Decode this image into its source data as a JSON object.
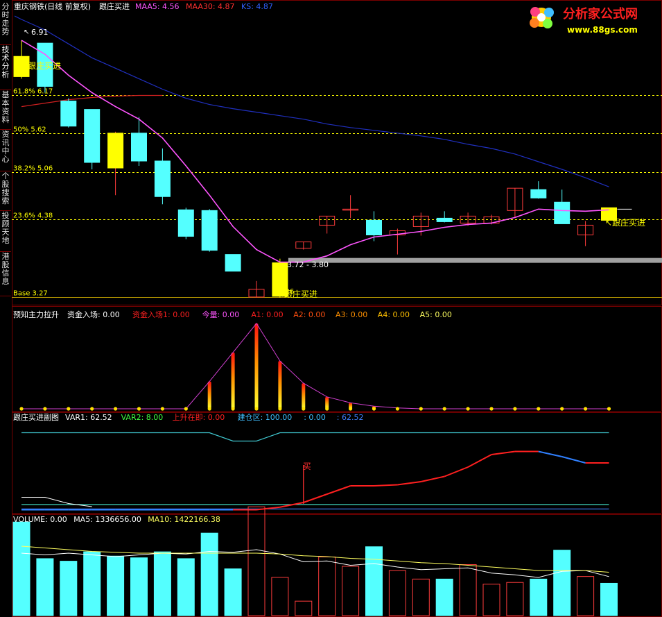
{
  "sidebar": {
    "tabs": [
      "分时走势",
      "技术分析",
      "基本资料",
      "资讯中心",
      "个股搜索",
      "投顾天地",
      "港股信息"
    ],
    "active": 1
  },
  "main": {
    "title": "重庆钢铁(日线 前复权)",
    "indicator_name": "跟庄买进",
    "items": [
      {
        "label": "MAA5:",
        "value": "4.56",
        "color": "#ff55ff"
      },
      {
        "label": "MAA30:",
        "value": "4.87",
        "color": "#ff3030"
      },
      {
        "label": "KS:",
        "value": "4.87",
        "color": "#3060ff"
      }
    ],
    "fib_levels": [
      {
        "label": "61.8% 6.17",
        "price": 6.17
      },
      {
        "label": "50% 5.62",
        "price": 5.62
      },
      {
        "label": "38.2% 5.06",
        "price": 5.06
      },
      {
        "label": "23.6% 4.38",
        "price": 4.38
      },
      {
        "label": "Base 3.27",
        "price": 3.27
      }
    ],
    "high_mark": "6.91",
    "low_mark": "3.26",
    "range_label": "3.72 - 3.80",
    "signal_label": "跟庄买进"
  },
  "panel1": {
    "title": "预知主力拉升",
    "items": [
      {
        "label": "资金入场:",
        "value": "0.00",
        "color": "#ffffff"
      },
      {
        "label": "资金入场1:",
        "value": "0.00",
        "color": "#ff2020"
      },
      {
        "label": "今量:",
        "value": "0.00",
        "color": "#ff55ff"
      },
      {
        "label": "A1:",
        "value": "0.00",
        "color": "#ff2020"
      },
      {
        "label": "A2:",
        "value": "0.00",
        "color": "#ff5010"
      },
      {
        "label": "A3:",
        "value": "0.00",
        "color": "#ff9000"
      },
      {
        "label": "A4:",
        "value": "0.00",
        "color": "#ffc000"
      },
      {
        "label": "A5:",
        "value": "0.00",
        "color": "#ffff60"
      }
    ]
  },
  "panel2": {
    "title": "跟庄买进副图",
    "items": [
      {
        "label": "VAR1:",
        "value": "62.52",
        "color": "#ffffff"
      },
      {
        "label": "VAR2:",
        "value": "8.00",
        "color": "#40ff40"
      },
      {
        "label": "上升在即:",
        "value": "0.00",
        "color": "#ff2020"
      },
      {
        "label": "建仓区:",
        "value": "100.00",
        "color": "#40c0ff"
      },
      {
        "label": ":",
        "value": "0.00",
        "color": "#40c0ff"
      },
      {
        "label": ":",
        "value": "62.52",
        "color": "#4080ff"
      }
    ],
    "buy_label": "买"
  },
  "panel3": {
    "title": "VOLUME:",
    "items": [
      {
        "label": "VOLUME:",
        "value": "0.00",
        "color": "#ffffff"
      },
      {
        "label": "MA5:",
        "value": "1336656.00",
        "color": "#ffffff"
      },
      {
        "label": "MA10:",
        "value": "1422166.38",
        "color": "#ffff60"
      }
    ]
  },
  "logo": {
    "text": "分析家公式网",
    "url": "www.88gs.com"
  },
  "colors": {
    "up": "#ff3c3c",
    "down": "#54ffff",
    "signal": "#ffff00",
    "ma5": "#ff55ff",
    "ma30": "#d02020",
    "ks": "#2030c0",
    "grid": "#7a0000"
  },
  "candles": [
    {
      "o": 6.72,
      "h": 6.95,
      "l": 6.4,
      "c": 6.43,
      "sig": true
    },
    {
      "o": 6.91,
      "h": 6.91,
      "l": 6.2,
      "c": 6.29
    },
    {
      "o": 6.08,
      "h": 6.12,
      "l": 5.7,
      "c": 5.72
    },
    {
      "o": 5.96,
      "h": 5.96,
      "l": 5.1,
      "c": 5.2
    },
    {
      "o": 5.62,
      "h": 5.64,
      "l": 4.73,
      "c": 5.12,
      "sig": true
    },
    {
      "o": 5.62,
      "h": 5.85,
      "l": 5.15,
      "c": 5.22
    },
    {
      "o": 5.22,
      "h": 5.4,
      "l": 4.6,
      "c": 4.71
    },
    {
      "o": 4.52,
      "h": 4.55,
      "l": 4.1,
      "c": 4.14
    },
    {
      "o": 4.51,
      "h": 4.53,
      "l": 3.92,
      "c": 3.94
    },
    {
      "o": 3.88,
      "h": 3.88,
      "l": 3.64,
      "c": 3.64
    },
    {
      "o": 3.27,
      "h": 3.5,
      "l": 3.26,
      "c": 3.38
    },
    {
      "o": 3.28,
      "h": 3.82,
      "l": 3.26,
      "c": 3.76,
      "sig": true
    },
    {
      "o": 3.97,
      "h": 4.06,
      "l": 3.95,
      "c": 4.06
    },
    {
      "o": 4.3,
      "h": 4.43,
      "l": 4.18,
      "c": 4.43
    },
    {
      "o": 4.52,
      "h": 4.73,
      "l": 4.4,
      "c": 4.53
    },
    {
      "o": 4.37,
      "h": 4.5,
      "l": 4.07,
      "c": 4.16
    },
    {
      "o": 4.16,
      "h": 4.25,
      "l": 3.88,
      "c": 4.22
    },
    {
      "o": 4.28,
      "h": 4.48,
      "l": 4.15,
      "c": 4.43
    },
    {
      "o": 4.4,
      "h": 4.5,
      "l": 4.34,
      "c": 4.35
    },
    {
      "o": 4.33,
      "h": 4.48,
      "l": 4.29,
      "c": 4.43
    },
    {
      "o": 4.33,
      "h": 4.45,
      "l": 4.31,
      "c": 4.42
    },
    {
      "o": 4.51,
      "h": 4.83,
      "l": 4.41,
      "c": 4.83
    },
    {
      "o": 4.81,
      "h": 4.93,
      "l": 4.68,
      "c": 4.69
    },
    {
      "o": 4.63,
      "h": 4.81,
      "l": 4.35,
      "c": 4.32
    },
    {
      "o": 4.16,
      "h": 4.36,
      "l": 4.0,
      "c": 4.3
    },
    {
      "o": 4.55,
      "h": 4.55,
      "l": 4.37,
      "c": 4.37,
      "sig": true
    }
  ],
  "maa5": [
    6.95,
    6.75,
    6.45,
    6.2,
    6.0,
    5.82,
    5.55,
    5.15,
    4.73,
    4.28,
    3.95,
    3.77,
    3.77,
    3.86,
    4.02,
    4.13,
    4.17,
    4.21,
    4.27,
    4.31,
    4.33,
    4.41,
    4.53,
    4.51,
    4.5,
    4.52
  ],
  "maa30": [
    6.0,
    6.05,
    6.1,
    6.13,
    6.15,
    6.16,
    6.16
  ],
  "ks": [
    7.25,
    7.1,
    6.9,
    6.7,
    6.55,
    6.4,
    6.25,
    6.12,
    6.03,
    5.97,
    5.92,
    5.87,
    5.82,
    5.75,
    5.7,
    5.66,
    5.62,
    5.58,
    5.53,
    5.46,
    5.4,
    5.32,
    5.21,
    5.1,
    4.98,
    4.85
  ],
  "fund_bars": [
    0,
    0,
    0,
    0,
    0,
    0,
    0,
    0,
    0.32,
    0.66,
    1.0,
    0.56,
    0.3,
    0.14,
    0.07,
    0.03,
    0.01,
    0,
    0,
    0,
    0,
    0,
    0,
    0,
    0,
    0
  ],
  "panel2_series": {
    "var1": [
      75,
      75,
      75,
      75,
      75,
      75,
      75,
      75,
      75,
      67,
      67,
      75,
      75,
      75,
      75,
      75,
      75,
      75,
      75,
      75,
      75,
      75,
      75,
      75,
      75,
      75
    ],
    "red": [
      1.0,
      1.0,
      1.0,
      1.0,
      1.0,
      1.0,
      1.0,
      1.0,
      1.0,
      1.0,
      1.0,
      3.5,
      8,
      16,
      24,
      24,
      25,
      28,
      33,
      42,
      54,
      57,
      57,
      52,
      46,
      46
    ],
    "low_line": [
      6,
      6,
      6,
      6,
      6,
      6,
      6,
      6,
      6,
      6,
      6,
      6,
      6,
      6,
      6,
      6,
      6,
      6,
      6,
      6,
      6,
      6,
      6,
      6,
      6,
      6
    ],
    "low_line2": [
      1.5,
      1.5,
      1.5,
      1.5,
      1.5,
      1.5,
      1.5,
      1.5,
      1.5,
      1.5,
      1.5,
      1.5,
      1.5,
      1.5,
      1.5,
      1.5,
      1.5,
      1.5,
      1.5,
      1.5,
      1.5,
      1.5,
      1.5,
      1.5,
      1.5,
      1.5
    ],
    "white": [
      13,
      13,
      7,
      4,
      4,
      4,
      4,
      4,
      4,
      4,
      4,
      4,
      4,
      4,
      4,
      4,
      4,
      4,
      4,
      4,
      4,
      4,
      4,
      4,
      4,
      4
    ]
  },
  "volume": {
    "bars": [
      1.1,
      0.67,
      0.64,
      0.75,
      0.7,
      0.68,
      0.75,
      0.67,
      0.97,
      0.55,
      1.28,
      0.45,
      0.17,
      0.69,
      0.58,
      0.81,
      0.53,
      0.43,
      0.43,
      0.6,
      0.37,
      0.39,
      0.43,
      0.77,
      0.46,
      0.38
    ],
    "ma5": [
      0.72,
      0.7,
      0.72,
      0.7,
      0.68,
      0.7,
      0.72,
      0.71,
      0.74,
      0.73,
      0.76,
      0.71,
      0.62,
      0.63,
      0.58,
      0.6,
      0.56,
      0.53,
      0.54,
      0.55,
      0.49,
      0.47,
      0.44,
      0.51,
      0.52,
      0.45
    ],
    "ma10": [
      0.8,
      0.78,
      0.76,
      0.74,
      0.73,
      0.72,
      0.72,
      0.72,
      0.72,
      0.72,
      0.72,
      0.71,
      0.69,
      0.68,
      0.66,
      0.65,
      0.63,
      0.61,
      0.6,
      0.58,
      0.56,
      0.54,
      0.52,
      0.52,
      0.52,
      0.5
    ]
  }
}
